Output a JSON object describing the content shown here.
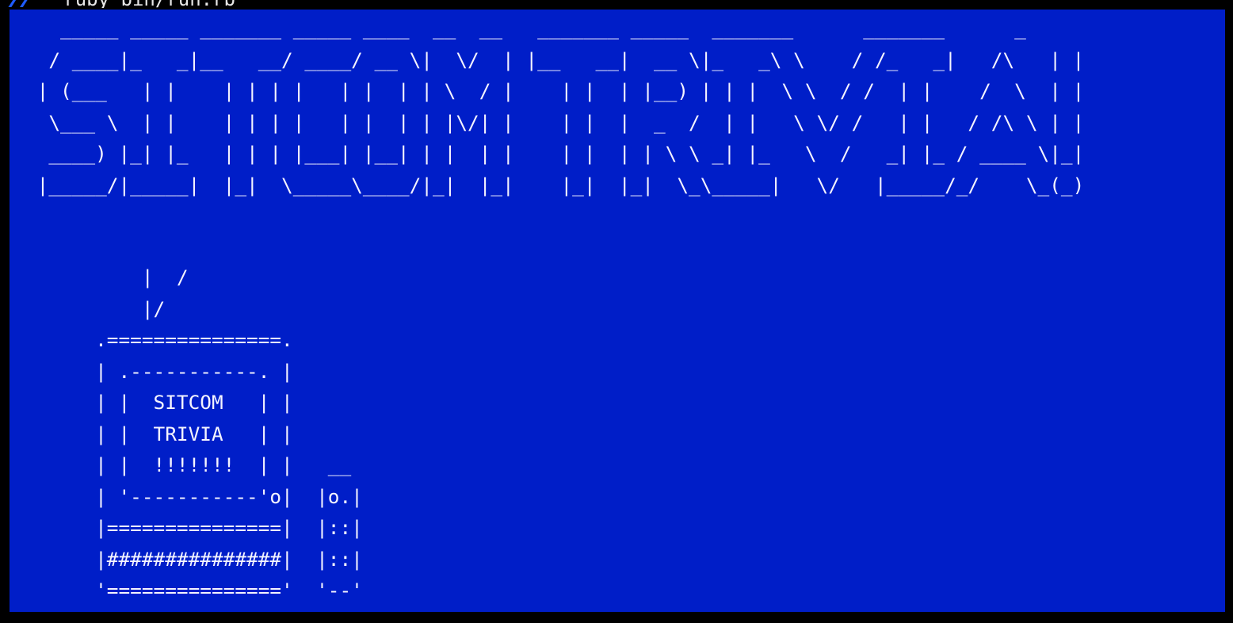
{
  "terminal": {
    "prompt_symbol": "❯❯",
    "command": "ruby bin/run.rb",
    "colors": {
      "window_bg": "#000000",
      "screen_bg": "#001ec8",
      "text": "#f4f4ff",
      "prompt": "#1f5cff"
    }
  },
  "screen": {
    "banner_ascii": "   _____ _____ _______ _____ ____  __  __   _______ _____  _______      _______      _\n  / ____|_   _|__   __/ ____/ __ \\|  \\/  | |__   __|  __ \\|_   _\\ \\    / /_   _|   /\\   | |\n | (___   | |    | | | |   | |  | | \\  / |    | |  | |__) | | |  \\ \\  / /  | |    /  \\  | |\n  \\___ \\  | |    | | | |   | |  | | |\\/| |    | |  |  _  /  | |   \\ \\/ /   | |   / /\\ \\ | |\n  ____) |_| |_   | | | |___| |__| | |  | |    | |  | | \\ \\ _| |_   \\  /   _| |_ / ____ \\|_|\n |_____/|_____|  |_|  \\_____\\____/|_|  |_|    |_|  |_|  \\_\\_____|   \\/   |_____/_/    \\_(_)",
    "tv_ascii": "          |  /\n          |/\n      .===============.\n      | .-----------. |\n      | |  SITCOM   | |\n      | |  TRIVIA   | |\n      | |  !!!!!!!  | |   __\n      | '-----------'o|  |o.|\n      |===============|  |::|\n      |###############|  |::|\n      '==============='  '--'"
  }
}
